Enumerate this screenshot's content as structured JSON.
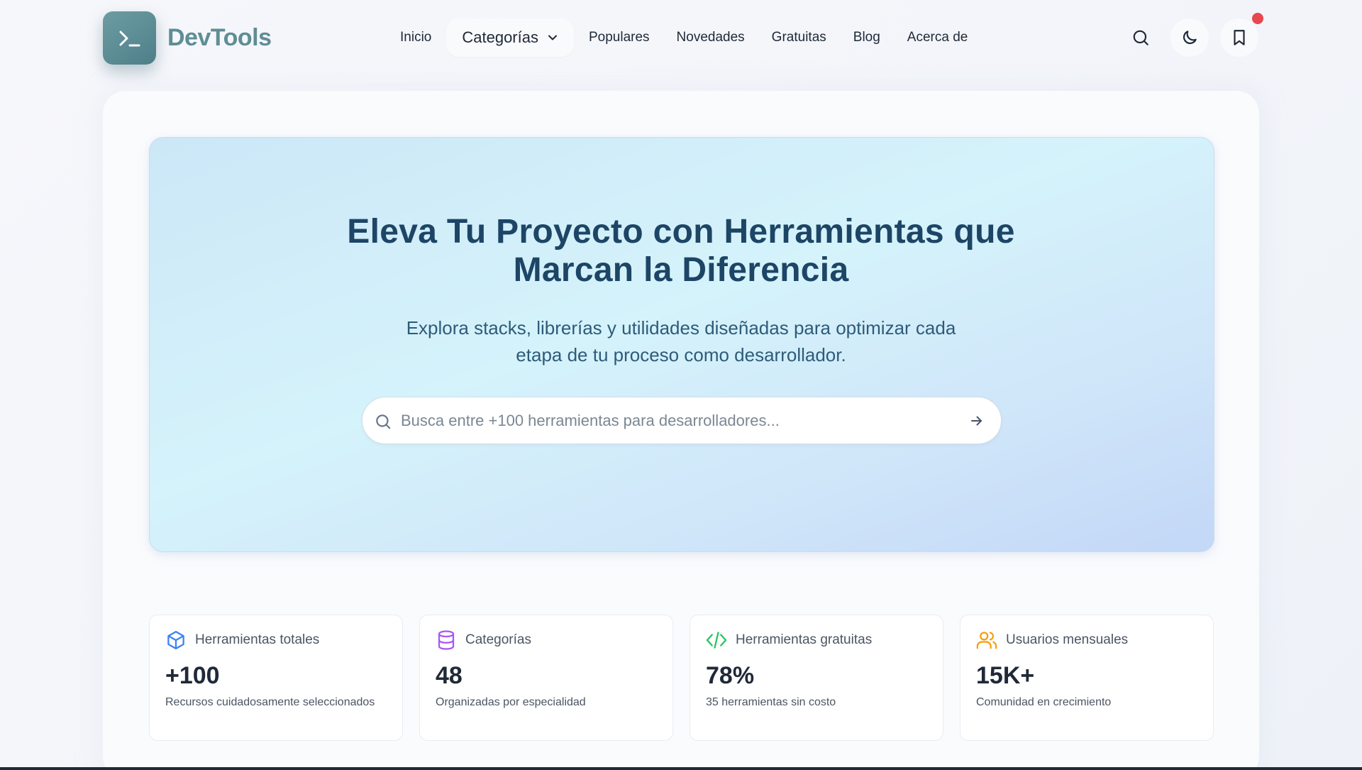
{
  "brand": {
    "name": "DevTools",
    "logo_glyph": ">_"
  },
  "nav": {
    "items": [
      "Inicio",
      "Categorías",
      "Populares",
      "Novedades",
      "Gratuitas",
      "Blog",
      "Acerca de"
    ]
  },
  "header_icons": [
    "search-icon",
    "moon-icon",
    "bookmark-icon"
  ],
  "hero": {
    "title_line1": "Eleva Tu Proyecto con Herramientas que",
    "title_line2": "Marcan la Diferencia",
    "subtitle_line1": "Explora stacks, librerías y utilidades diseñadas para optimizar cada",
    "subtitle_line2": "etapa de tu proceso como desarrollador.",
    "search_placeholder": "Busca entre +100 herramientas para desarrolladores..."
  },
  "stats": [
    {
      "icon": "box-icon",
      "label": "Herramientas totales",
      "value": "+100",
      "desc": "Recursos cuidadosamente seleccionados",
      "color": "#3b82f6"
    },
    {
      "icon": "database-icon",
      "label": "Categorías",
      "value": "48",
      "desc": "Organizadas por especialidad",
      "color": "#a855f7"
    },
    {
      "icon": "code-icon",
      "label": "Herramientas gratuitas",
      "value": "78%",
      "desc": "35 herramientas sin costo",
      "color": "#22c55e"
    },
    {
      "icon": "users-icon",
      "label": "Usuarios mensuales",
      "value": "15K+",
      "desc": "Comunidad en crecimiento",
      "color": "#f59e0b"
    }
  ],
  "colors": {
    "accent": "#5e8d95",
    "title": "#1d4565",
    "notification": "#e5484d"
  }
}
